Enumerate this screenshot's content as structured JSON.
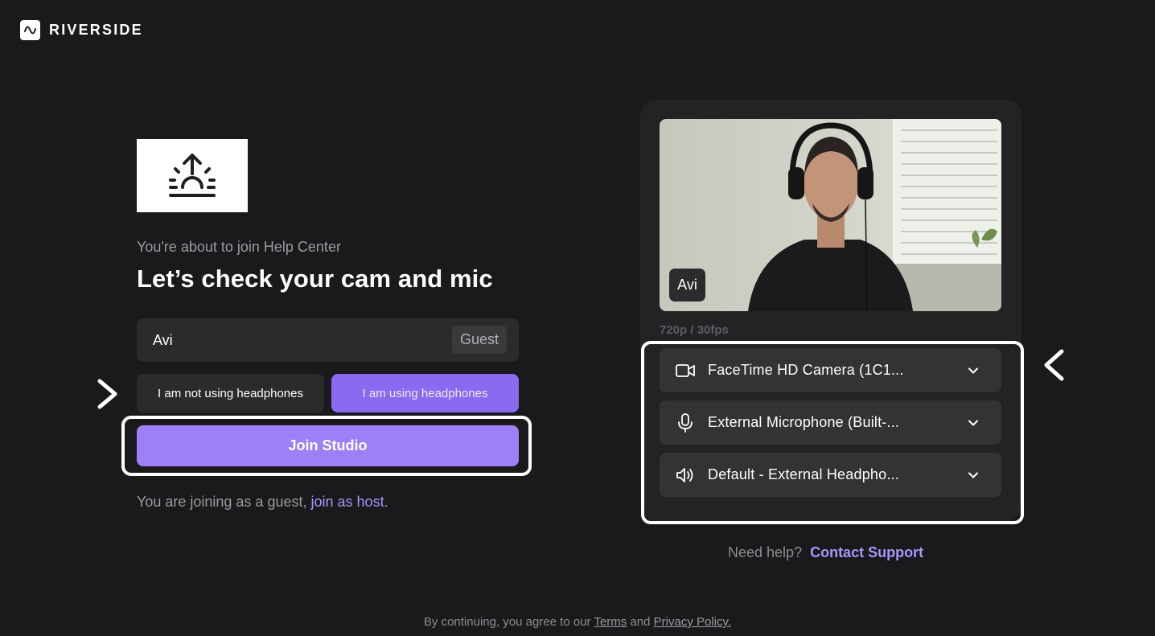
{
  "app": {
    "brand": "RIVERSIDE",
    "accent_color": "#9c80f7",
    "background_color": "#1a191b"
  },
  "join": {
    "subtitle": "You're about to join Help Center",
    "headline": "Let’s check your cam and mic",
    "name_value": "Avi",
    "role_badge": "Guest",
    "headphones_options": [
      "I am not using headphones",
      "I am using headphones"
    ],
    "headphones_selected": "I am using headphones",
    "join_button": "Join Studio",
    "guest_note": "You are joining as a guest,",
    "host_link": "join as host."
  },
  "preview": {
    "participant_name": "Avi",
    "resolution": "720p / 30fps"
  },
  "devices": [
    {
      "icon": "camera-icon",
      "label": "FaceTime HD Camera (1C1..."
    },
    {
      "icon": "microphone-icon",
      "label": "External Microphone (Built-..."
    },
    {
      "icon": "speaker-icon",
      "label": "Default - External Headpho..."
    }
  ],
  "help": {
    "prompt": "Need help?",
    "link": "Contact Support"
  },
  "footer": {
    "prefix": "By continuing, you agree to our",
    "terms": "Terms",
    "and": "and",
    "privacy": "Privacy Policy."
  }
}
